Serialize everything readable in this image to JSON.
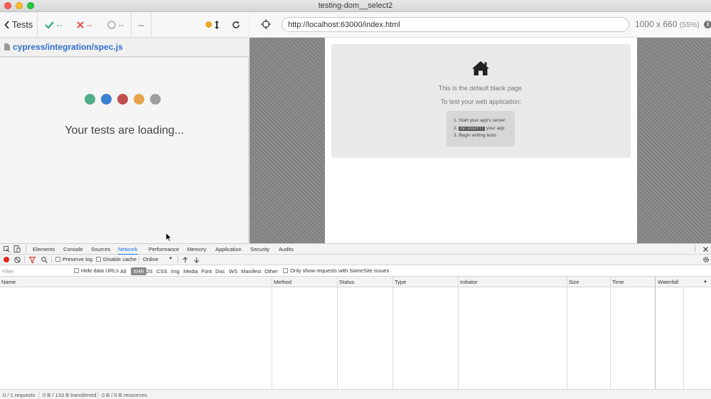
{
  "window": {
    "title": "testing-dom__select2"
  },
  "reporter": {
    "tests_label": "Tests",
    "passed": "--",
    "failed": "--",
    "pending": "--",
    "duration": "--",
    "spec_path": "cypress/integration/spec.js",
    "loading_text": "Your tests are loading...",
    "loader_colors": [
      "#4fae86",
      "#3a7fd0",
      "#c0504d",
      "#e6a44a",
      "#9e9e9e"
    ],
    "colors": {
      "pass": "#2bab74",
      "fail": "#e84e4e",
      "link": "#2f6fcc",
      "running": "#f0a623"
    }
  },
  "aut": {
    "url": "http://localhost:63000/index.html",
    "viewport": "1000 x 660",
    "scale": "(55%)",
    "blank_page": {
      "line1": "This is the default blank page.",
      "line2": "To test your web application:",
      "step1": "1. Start your app's server",
      "step2_prefix": "2.",
      "step2_code": "cy.visit()",
      "step2_suffix": "your app",
      "step3": "3. Begin writing tests"
    }
  },
  "devtools": {
    "tabs": [
      "Elements",
      "Console",
      "Sources",
      "Network",
      "Performance",
      "Memory",
      "Application",
      "Security",
      "Audits"
    ],
    "active_tab": "Network",
    "preserve_log": "Preserve log",
    "disable_cache": "Disable cache",
    "throttle": "Online",
    "filter_placeholder": "Filter",
    "hide_data_urls": "Hide data URLs",
    "types": [
      "All",
      "XHR",
      "JS",
      "CSS",
      "Img",
      "Media",
      "Font",
      "Doc",
      "WS",
      "Manifest",
      "Other"
    ],
    "active_type": "XHR",
    "samesite": "Only show requests with SameSite issues",
    "columns": [
      "Name",
      "Method",
      "Status",
      "Type",
      "Initiator",
      "Size",
      "Time",
      "Waterfall"
    ],
    "status": {
      "requests": "0 / 1 requests",
      "transferred": "0 B / 133 B transferred",
      "resources": "0 B / 0 B resources"
    }
  }
}
